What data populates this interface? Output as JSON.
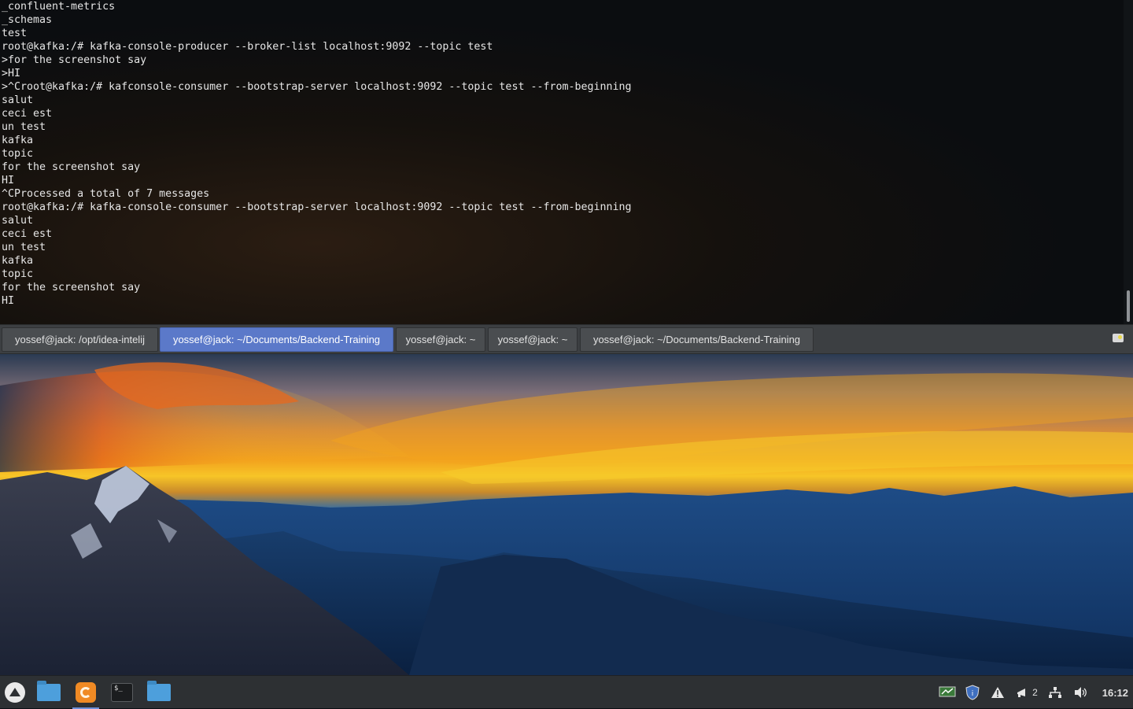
{
  "terminal": {
    "lines": [
      "_confluent-metrics",
      "_schemas",
      "test",
      "root@kafka:/# kafka-console-producer --broker-list localhost:9092 --topic test",
      ">for the screenshot say",
      ">HI",
      ">^Croot@kafka:/# kafconsole-consumer --bootstrap-server localhost:9092 --topic test --from-beginning",
      "salut",
      "ceci est",
      "un test",
      "kafka",
      "topic",
      "for the screenshot say",
      "HI",
      "^CProcessed a total of 7 messages",
      "root@kafka:/# kafka-console-consumer --bootstrap-server localhost:9092 --topic test --from-beginning",
      "salut",
      "ceci est",
      "un test",
      "kafka",
      "topic",
      "for the screenshot say",
      "HI"
    ],
    "scroll_position": 0.95
  },
  "tabs": [
    {
      "label": "yossef@jack: /opt/idea-intelij",
      "active": false
    },
    {
      "label": "yossef@jack: ~/Documents/Backend-Training",
      "active": true
    },
    {
      "label": "yossef@jack: ~",
      "active": false
    },
    {
      "label": "yossef@jack: ~",
      "active": false
    },
    {
      "label": "yossef@jack: ~/Documents/Backend-Training",
      "active": false
    }
  ],
  "taskbar": {
    "apps": [
      {
        "name": "menu-icon"
      },
      {
        "name": "file-manager-icon"
      },
      {
        "name": "firefox-icon",
        "active": true
      },
      {
        "name": "terminal-icon"
      },
      {
        "name": "folder-icon"
      }
    ],
    "tray": {
      "notification_count": "2",
      "clock": "16:12"
    }
  },
  "colors": {
    "active_tab": "#5b79c9",
    "taskbar": "#2d3033",
    "tabbar": "#3c3f42"
  }
}
